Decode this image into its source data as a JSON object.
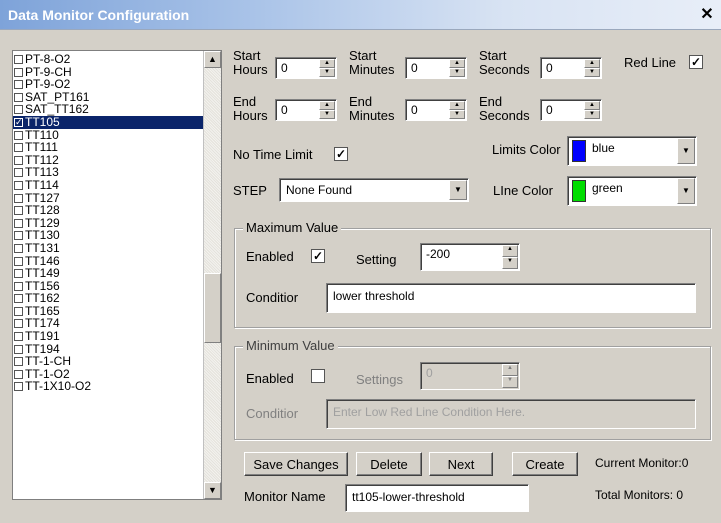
{
  "window": {
    "title": "Data Monitor Configuration",
    "close_glyph": "✕"
  },
  "monitor_list": {
    "items": [
      {
        "label": "PT-8-O2",
        "checked": false
      },
      {
        "label": "PT-9-CH",
        "checked": false
      },
      {
        "label": "PT-9-O2",
        "checked": false
      },
      {
        "label": "SAT_PT161",
        "checked": false
      },
      {
        "label": "SAT_TT162",
        "checked": false
      },
      {
        "label": "TT105",
        "checked": true,
        "selected": true
      },
      {
        "label": "TT110",
        "checked": false
      },
      {
        "label": "TT111",
        "checked": false
      },
      {
        "label": "TT112",
        "checked": false
      },
      {
        "label": "TT113",
        "checked": false
      },
      {
        "label": "TT114",
        "checked": false
      },
      {
        "label": "TT127",
        "checked": false
      },
      {
        "label": "TT128",
        "checked": false
      },
      {
        "label": "TT129",
        "checked": false
      },
      {
        "label": "TT130",
        "checked": false
      },
      {
        "label": "TT131",
        "checked": false
      },
      {
        "label": "TT146",
        "checked": false
      },
      {
        "label": "TT149",
        "checked": false
      },
      {
        "label": "TT156",
        "checked": false
      },
      {
        "label": "TT162",
        "checked": false
      },
      {
        "label": "TT165",
        "checked": false
      },
      {
        "label": "TT174",
        "checked": false
      },
      {
        "label": "TT191",
        "checked": false
      },
      {
        "label": "TT194",
        "checked": false
      },
      {
        "label": "TT-1-CH",
        "checked": false
      },
      {
        "label": "TT-1-O2",
        "checked": false
      },
      {
        "label": "TT-1X10-O2",
        "checked": false
      }
    ],
    "scroll_up_glyph": "▲",
    "scroll_down_glyph": "▼"
  },
  "time": {
    "start_hours_label": "Start\nHours",
    "start_hours": "0",
    "start_minutes_label": "Start\nMinutes",
    "start_minutes": "0",
    "start_seconds_label": "Start\nSeconds",
    "start_seconds": "0",
    "end_hours_label": "End\nHours",
    "end_hours": "0",
    "end_minutes_label": "End\nMinutes",
    "end_minutes": "0",
    "end_seconds_label": "End\nSeconds",
    "end_seconds": "0",
    "no_time_limit_label": "No Time Limit",
    "no_time_limit_checked": true
  },
  "red_line": {
    "label": "Red Line",
    "checked": true
  },
  "limits_color": {
    "label": "Limits Color",
    "value": "blue",
    "swatch": "#0000ff"
  },
  "line_color": {
    "label": "LIne Color",
    "value": "green",
    "swatch": "#00dd00"
  },
  "step": {
    "label": "STEP",
    "value": "None Found"
  },
  "maximum": {
    "title": "Maximum Value",
    "enabled_label": "Enabled",
    "enabled_checked": true,
    "setting_label": "Setting",
    "setting_value": "-200",
    "condition_label": "Conditior",
    "condition_value": "lower threshold"
  },
  "minimum": {
    "title": "Minimum Value",
    "enabled_label": "Enabled",
    "enabled_checked": false,
    "settings_label": "Settings",
    "settings_value": "0",
    "condition_label": "Conditior",
    "condition_placeholder": "Enter Low Red Line Condition Here."
  },
  "buttons": {
    "save": "Save Changes",
    "delete": "Delete",
    "next": "Next",
    "create": "Create"
  },
  "monitor_name": {
    "label": "Monitor Name",
    "value": "tt105-lower-threshold"
  },
  "status": {
    "current_monitor": "Current Monitor:0",
    "total_monitors": "Total Monitors: 0"
  },
  "glyphs": {
    "check": "✓",
    "spin_up": "▲",
    "spin_down": "▼",
    "drop": "▼"
  }
}
